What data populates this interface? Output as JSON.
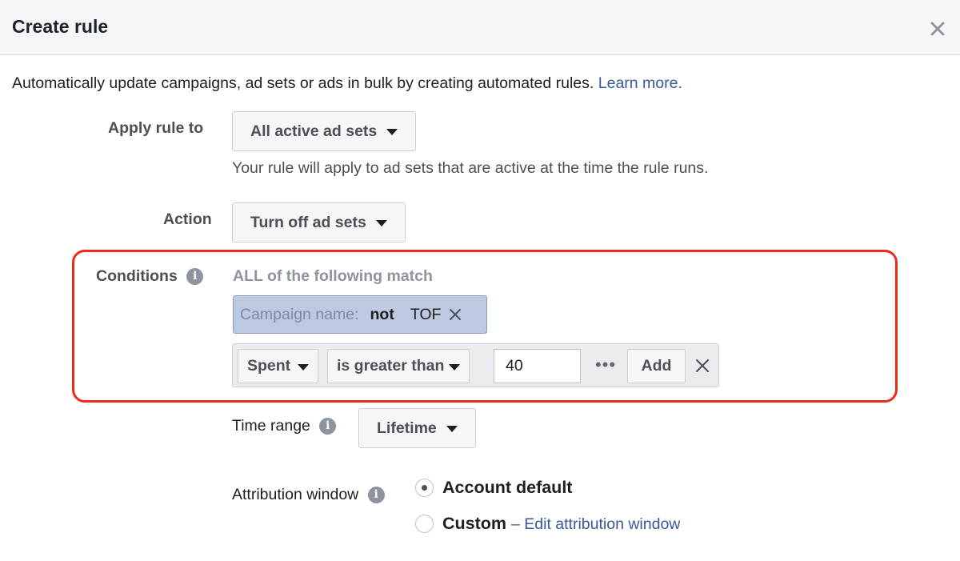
{
  "header": {
    "title": "Create rule",
    "close_icon": "close-icon"
  },
  "intro": {
    "text": "Automatically update campaigns, ad sets or ads in bulk by creating automated rules.",
    "link": "Learn more."
  },
  "apply_rule": {
    "label": "Apply rule to",
    "value": "All active ad sets",
    "helper": "Your rule will apply to ad sets that are active at the time the rule runs."
  },
  "action": {
    "label": "Action",
    "value": "Turn off ad sets"
  },
  "conditions": {
    "label": "Conditions",
    "info_icon": "info-icon",
    "match_text": "ALL of the following match",
    "filter": {
      "key": "Campaign name:",
      "operator": "not",
      "value": "TOF"
    },
    "new_condition": {
      "metric": "Spent",
      "operator": "is greater than",
      "value": "40",
      "more": "•••",
      "add_label": "Add"
    },
    "highlight_color": "#ee2a1b"
  },
  "time_range": {
    "label": "Time range",
    "value": "Lifetime"
  },
  "attribution": {
    "label": "Attribution window",
    "options": [
      {
        "label": "Account default",
        "selected": true
      },
      {
        "label": "Custom",
        "selected": false,
        "link": "– Edit attribution window"
      }
    ]
  },
  "colors": {
    "link": "#385898",
    "token_bg": "#bcc9e1",
    "header_bg": "#f5f6f7"
  }
}
